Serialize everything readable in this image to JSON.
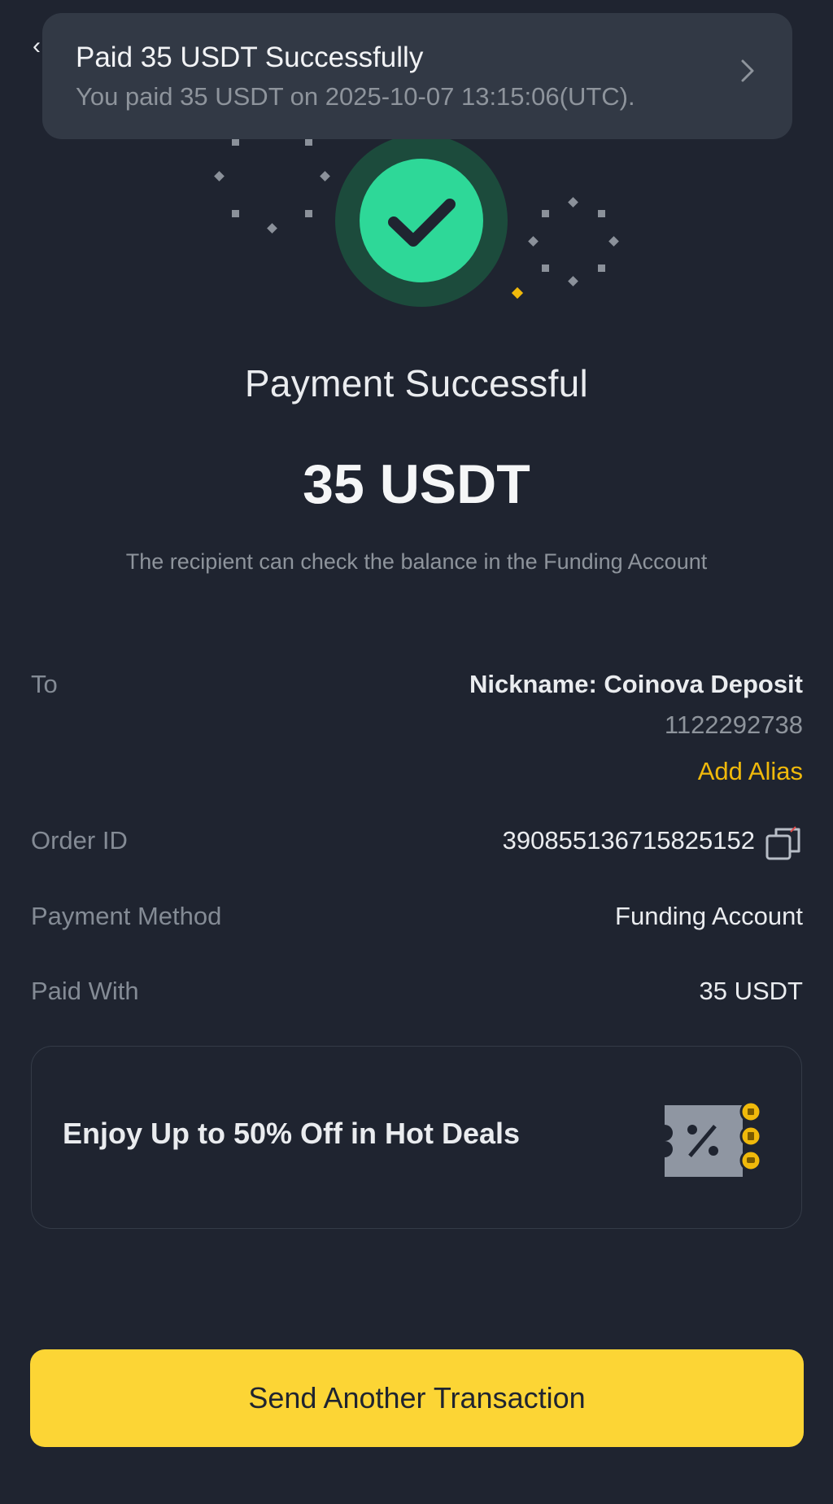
{
  "toast": {
    "title": "Paid 35 USDT Successfully",
    "subtitle": "You paid 35 USDT on 2025-10-07 13:15:06(UTC)."
  },
  "header": {
    "back_icon": "back-arrow-icon"
  },
  "status": {
    "title": "Payment Successful",
    "amount": "35 USDT",
    "note": "The recipient can check the balance in the Funding Account"
  },
  "details": {
    "to_label": "To",
    "to_name": "Nickname: Coinova Deposit",
    "to_id": "1122292738",
    "add_alias": "Add Alias",
    "order_label": "Order ID",
    "order_id": "390855136715825152",
    "method_label": "Payment Method",
    "method_value": "Funding Account",
    "paid_label": "Paid With",
    "paid_value": "35 USDT"
  },
  "promo": {
    "text": "Enjoy Up to 50% Off in Hot Deals"
  },
  "cta": {
    "label": "Send Another Transaction"
  },
  "colors": {
    "background": "#1f2430",
    "accent_yellow": "#fcd535",
    "success_green": "#2ed898",
    "link_yellow": "#f0b90b"
  }
}
